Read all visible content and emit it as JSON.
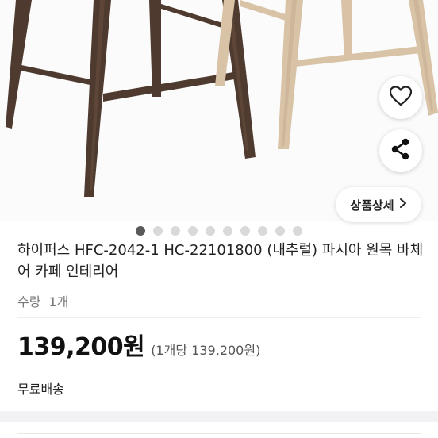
{
  "product": {
    "title": "하이퍼스 HFC-2042-1 HC-22101800 (내추럴) 파시아 원목 바체어 카페 인테리어",
    "quantity_label": "수량",
    "quantity_value": "1개",
    "price": "139,200원",
    "unit_price": "(1개당 139,200원)",
    "shipping": "무료배송"
  },
  "actions": {
    "detail_label": "상품상세"
  },
  "carousel": {
    "total": 10,
    "active_index": 0
  },
  "icons": {
    "like": "heart-icon",
    "share": "share-icon",
    "detail": "chevron-right-icon"
  },
  "colors": {
    "dark_wood": "#4e3a2e",
    "light_wood": "#d8c3a7",
    "active_dot": "#5a5a5a",
    "inactive_dot": "#d9d9d9"
  }
}
